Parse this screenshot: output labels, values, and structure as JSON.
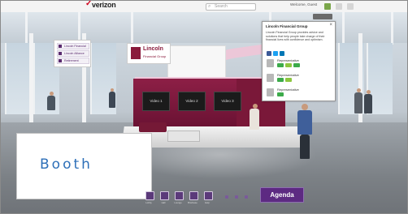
{
  "header": {
    "brand": "verizon",
    "search_placeholder": "Search",
    "user_text": "Welcome, Guest"
  },
  "booth": {
    "company_name": "Lincoln",
    "company_sub": "Financial Group",
    "screens": [
      "Video 1",
      "Video 2",
      "Video 3"
    ],
    "label": "Booth"
  },
  "poster_stand": {
    "items": [
      "Lincoln Financial",
      "Lincoln Alliance",
      "Retirement"
    ]
  },
  "chat": {
    "title": "Lincoln Financial Group",
    "description": "Lincoln Financial Group provides advice and solutions that help people take charge of their financial lives with confidence and optimism.",
    "reps": [
      {
        "name": "Representative"
      },
      {
        "name": "Representative"
      },
      {
        "name": "Representative"
      }
    ]
  },
  "toolbar": {
    "agenda_label": "Agenda",
    "captions": [
      "Lobby",
      "Hall",
      "Lounge",
      "Briefcase",
      "Help"
    ]
  },
  "colors": {
    "accent_purple": "#5d2a82",
    "booth_maroon": "#8d1f46",
    "label_blue": "#2d6fb8",
    "brand_red": "#d0021b"
  }
}
